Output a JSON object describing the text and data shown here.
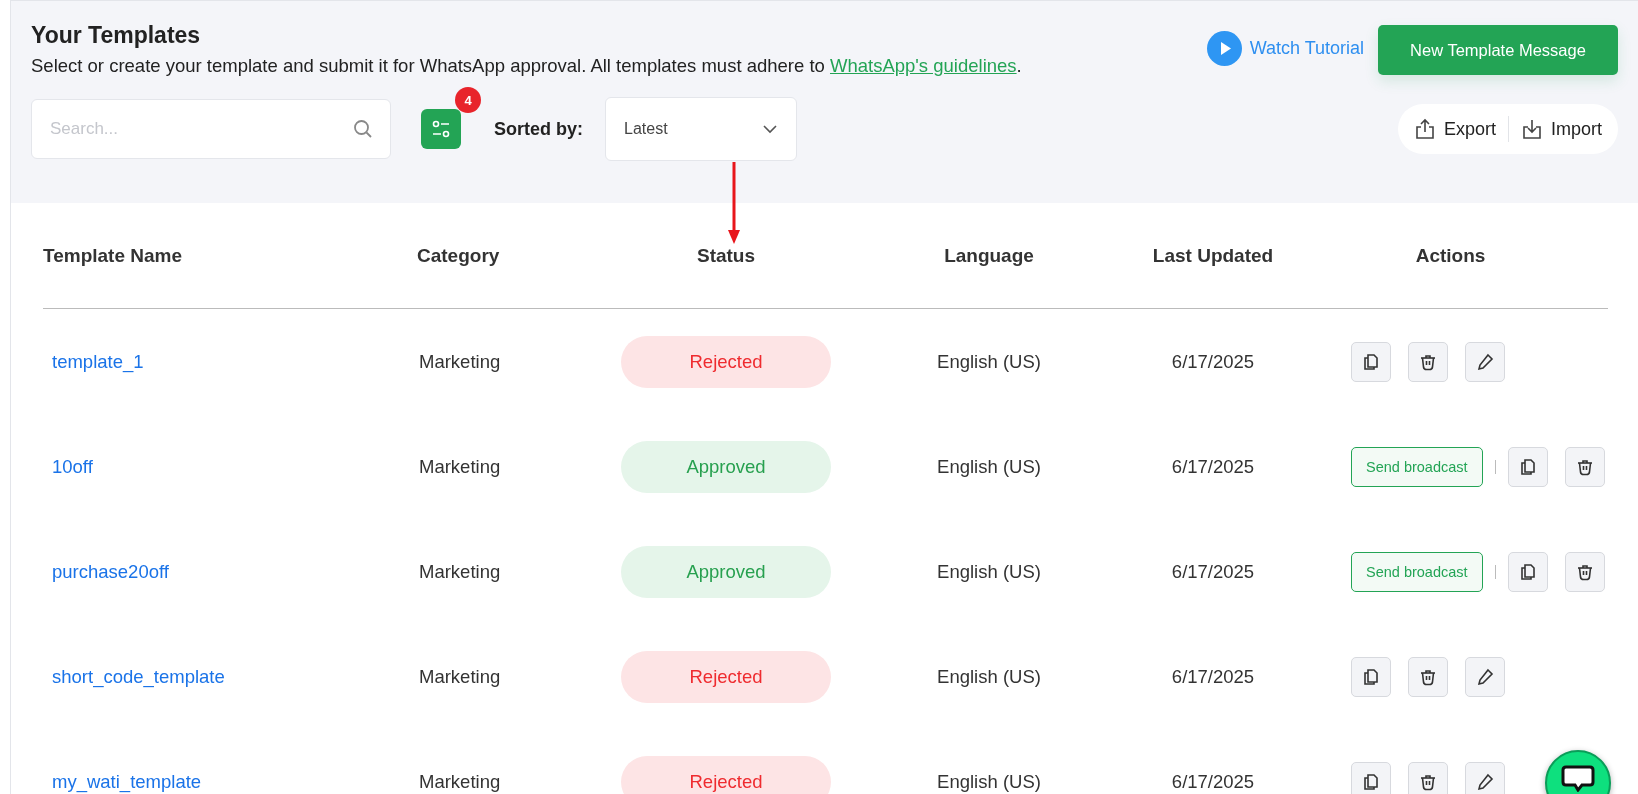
{
  "header": {
    "title": "Your Templates",
    "subtitle": "Select or create your template and submit it for WhatsApp approval. All templates must adhere to ",
    "subtitle_link": "WhatsApp's guidelines",
    "subtitle_end": ".",
    "watch_tutorial": "Watch Tutorial",
    "new_button": "New Template Message"
  },
  "toolbar": {
    "search": {
      "placeholder": "Search..."
    },
    "filter_badge": "4",
    "sort_label": "Sorted by:",
    "sort_value": "Latest",
    "export": "Export",
    "import": "Import"
  },
  "table": {
    "columns": [
      "Template Name",
      "Category",
      "Status",
      "Language",
      "Last Updated",
      "Actions"
    ],
    "rows": [
      {
        "name": "template_1",
        "category": "Marketing",
        "status": {
          "kind": "rejected",
          "label": "Rejected"
        },
        "language": "English (US)",
        "updated": "6/17/2025",
        "actions": [
          {
            "kind": "copy"
          },
          {
            "kind": "delete"
          },
          {
            "kind": "edit"
          }
        ]
      },
      {
        "name": "10off",
        "category": "Marketing",
        "status": {
          "kind": "approved",
          "label": "Approved"
        },
        "language": "English (US)",
        "updated": "6/17/2025",
        "actions": [
          {
            "kind": "broadcast",
            "label": "Send broadcast"
          },
          {
            "kind": "separator"
          },
          {
            "kind": "copy"
          },
          {
            "kind": "delete"
          }
        ]
      },
      {
        "name": "purchase20off",
        "category": "Marketing",
        "status": {
          "kind": "approved",
          "label": "Approved"
        },
        "language": "English (US)",
        "updated": "6/17/2025",
        "actions": [
          {
            "kind": "broadcast",
            "label": "Send broadcast"
          },
          {
            "kind": "separator"
          },
          {
            "kind": "copy"
          },
          {
            "kind": "delete"
          }
        ]
      },
      {
        "name": "short_code_template",
        "category": "Marketing",
        "status": {
          "kind": "rejected",
          "label": "Rejected"
        },
        "language": "English (US)",
        "updated": "6/17/2025",
        "actions": [
          {
            "kind": "copy"
          },
          {
            "kind": "delete"
          },
          {
            "kind": "edit"
          }
        ]
      },
      {
        "name": "my_wati_template",
        "category": "Marketing",
        "status": {
          "kind": "rejected",
          "label": "Rejected"
        },
        "language": "English (US)",
        "updated": "6/17/2025",
        "actions": [
          {
            "kind": "copy"
          },
          {
            "kind": "delete"
          },
          {
            "kind": "edit"
          }
        ]
      }
    ]
  }
}
